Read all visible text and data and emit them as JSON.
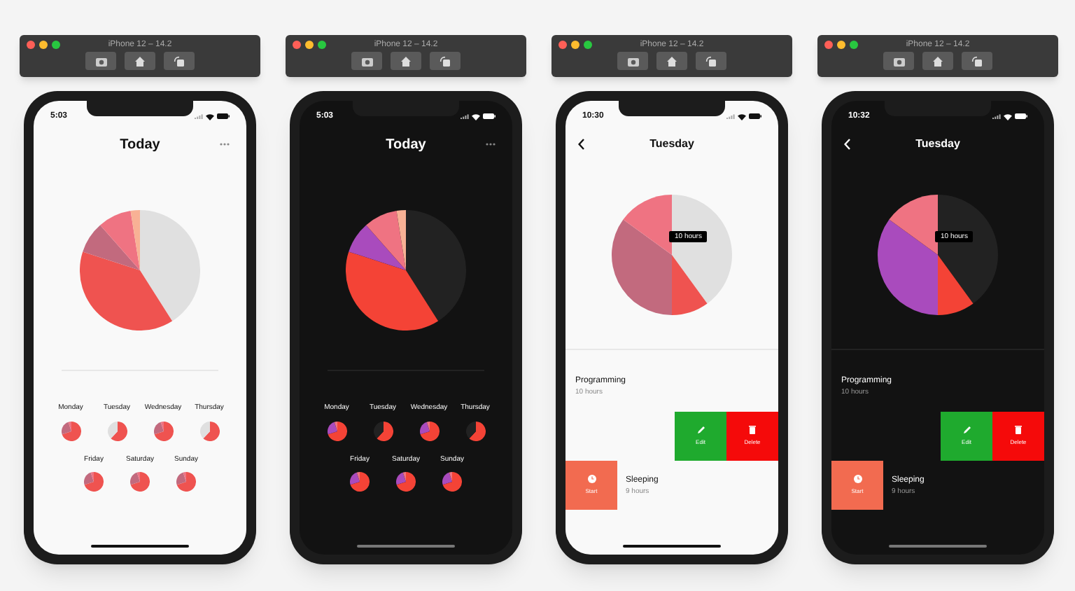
{
  "simulators": [
    {
      "title": "iPhone 12 – 14.2",
      "dark_mode": false,
      "screen": {
        "kind": "overview",
        "time": "5:03",
        "title": "Today",
        "days": [
          "Monday",
          "Tuesday",
          "Wednesday",
          "Thursday",
          "Friday",
          "Saturday",
          "Sunday"
        ]
      }
    },
    {
      "title": "iPhone 12 – 14.2",
      "dark_mode": true,
      "screen": {
        "kind": "overview",
        "time": "5:03",
        "title": "Today",
        "days": [
          "Monday",
          "Tuesday",
          "Wednesday",
          "Thursday",
          "Friday",
          "Saturday",
          "Sunday"
        ]
      }
    },
    {
      "title": "iPhone 12 – 14.2",
      "dark_mode": false,
      "screen": {
        "kind": "detail",
        "time": "10:30",
        "title": "Tuesday",
        "tooltip": "10 hours",
        "rows": [
          {
            "kind": "entry",
            "name": "Programming",
            "duration": "10 hours"
          },
          {
            "kind": "actions",
            "actions": [
              {
                "kind": "edit",
                "label": "Edit"
              },
              {
                "kind": "delete",
                "label": "Delete"
              }
            ]
          },
          {
            "kind": "swiped",
            "action": "Start",
            "name": "Sleeping",
            "duration": "9 hours"
          }
        ]
      }
    },
    {
      "title": "iPhone 12 – 14.2",
      "dark_mode": true,
      "screen": {
        "kind": "detail",
        "time": "10:32",
        "title": "Tuesday",
        "tooltip": "10 hours",
        "rows": [
          {
            "kind": "entry",
            "name": "Programming",
            "duration": "10 hours"
          },
          {
            "kind": "actions",
            "actions": [
              {
                "kind": "edit",
                "label": "Edit"
              },
              {
                "kind": "delete",
                "label": "Delete"
              }
            ]
          },
          {
            "kind": "swiped",
            "action": "Start",
            "name": "Sleeping",
            "duration": "9 hours"
          }
        ]
      }
    }
  ]
}
